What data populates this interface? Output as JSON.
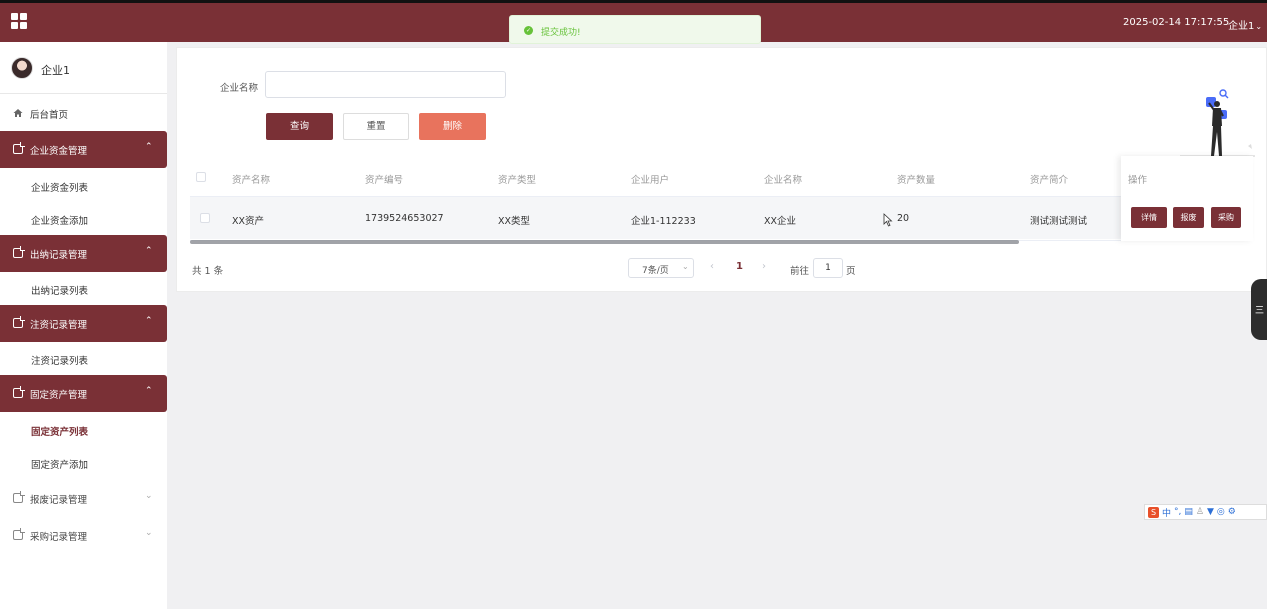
{
  "header": {
    "datetime": "2025-02-14 17:17:55",
    "user": "企业1",
    "bg_color": "#7a3036"
  },
  "toast": {
    "message": "提交成功!",
    "icon": "check-circle-icon"
  },
  "sidebar": {
    "user_name": "企业1",
    "home": "后台首页",
    "groups": [
      {
        "label": "企业资金管理",
        "items": [
          "企业资金列表",
          "企业资金添加"
        ]
      },
      {
        "label": "出纳记录管理",
        "items": [
          "出纳记录列表"
        ]
      },
      {
        "label": "注资记录管理",
        "items": [
          "注资记录列表"
        ]
      },
      {
        "label": "固定资产管理",
        "items": [
          "固定资产列表",
          "固定资产添加"
        ]
      },
      {
        "label": "报废记录管理",
        "items": []
      },
      {
        "label": "采购记录管理",
        "items": []
      }
    ]
  },
  "search": {
    "label": "企业名称",
    "value": "",
    "query_btn": "查询",
    "reset_btn": "重置",
    "delete_btn": "删除"
  },
  "table": {
    "columns": [
      "资产名称",
      "资产编号",
      "资产类型",
      "企业用户",
      "企业名称",
      "资产数量",
      "资产简介",
      "操作"
    ],
    "rows": [
      {
        "name": "XX资产",
        "code": "1739524653027",
        "type": "XX类型",
        "user": "企业1-112233",
        "company": "XX企业",
        "quantity": "20",
        "intro": "测试测试测试"
      }
    ],
    "actions": [
      "详情",
      "报废",
      "采购"
    ]
  },
  "pagination": {
    "total": "共 1 条",
    "page_size": "7条/页",
    "current": "1",
    "goto_label": "前往",
    "goto_value": "1",
    "goto_unit": "页"
  },
  "float_tab": "三",
  "ime": {
    "lang": "中"
  }
}
